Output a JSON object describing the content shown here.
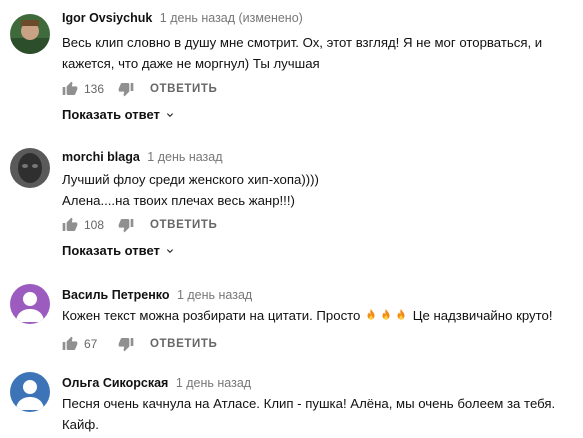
{
  "comments": [
    {
      "author": "Igor Ovsiychuk",
      "meta": "1 день назад (изменено)",
      "text": "Весь клип словно в душу мне смотрит. Ох, этот взгляд! Я не мог оторваться, и кажется, что даже не моргнул) Ты лучшая",
      "likes": "136",
      "reply_label": "ОТВЕТИТЬ",
      "show_replies_label": "Показать ответ",
      "avatar_color": "#3f6a3c"
    },
    {
      "author": "morchi blaga",
      "meta": "1 день назад",
      "text_lines": [
        "Лучший флоу среди женского хип-хопа))))",
        "Алена....на твоих плечах весь жанр!!!)"
      ],
      "likes": "108",
      "reply_label": "ОТВЕТИТЬ",
      "show_replies_label": "Показать ответ",
      "avatar_color": "#4a4a4a"
    },
    {
      "author": "Василь Петренко",
      "meta": "1 день назад",
      "text_before_emoji": "Кожен текст можна розбирати на цитати. Просто ",
      "emoji": [
        "fire-icon",
        "fire-icon",
        "fire-icon"
      ],
      "text_after_emoji": " Це надзвичайно круто!",
      "likes": "67",
      "reply_label": "ОТВЕТИТЬ",
      "avatar_color": "#9c5bbf"
    },
    {
      "author": "Ольга Сикорская",
      "meta": "1 день назад",
      "text": "Песня очень качнула на Атласе. Клип - пушка! Алёна, мы очень болеем за тебя. Кайф.",
      "avatar_color": "#3d74b8"
    }
  ],
  "icons": {
    "like": "thumb-up-icon",
    "dislike": "thumb-down-icon",
    "expand": "chevron-down-icon",
    "avatar_placeholder": "person-icon"
  }
}
